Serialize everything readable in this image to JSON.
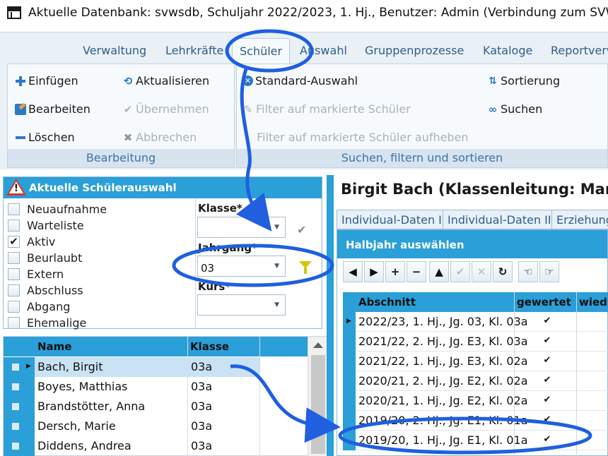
{
  "window": {
    "title": "Aktuelle Datenbank: svwsdb, Schuljahr 2022/2023, 1. Hj., Benutzer: Admin (Verbindung zum SVWS-Serv"
  },
  "ribbon": {
    "tabs": [
      "Verwaltung",
      "Lehrkräfte",
      "Schüler",
      "Auswahl",
      "Gruppenprozesse",
      "Kataloge",
      "Reportverw"
    ],
    "groups": {
      "bearbeitung": {
        "label": "Bearbeitung",
        "buttons": {
          "einfuegen": "Einfügen",
          "bearbeiten": "Bearbeiten",
          "loeschen": "Löschen",
          "aktualisieren": "Aktualisieren",
          "uebernehmen": "Übernehmen",
          "abbrechen": "Abbrechen"
        }
      },
      "suchen": {
        "label": "Suchen, filtern und sortieren",
        "buttons": {
          "standard": "Standard-Auswahl",
          "filter_markiert": "Filter auf markierte Schüler",
          "filter_aufheben": "Filter auf markierte Schüler aufheben",
          "sortierung": "Sortierung",
          "suchen": "Suchen"
        }
      }
    }
  },
  "selection": {
    "title": "Aktuelle Schülerauswahl",
    "statuses": [
      {
        "label": "Neuaufnahme",
        "checked": false
      },
      {
        "label": "Warteliste",
        "checked": false
      },
      {
        "label": "Aktiv",
        "checked": true
      },
      {
        "label": "Beurlaubt",
        "checked": false
      },
      {
        "label": "Extern",
        "checked": false
      },
      {
        "label": "Abschluss",
        "checked": false
      },
      {
        "label": "Abgang",
        "checked": false
      },
      {
        "label": "Ehemalige",
        "checked": false
      }
    ],
    "check_mark": "✔",
    "filters": {
      "klasse": {
        "label": "Klasse*",
        "value": ""
      },
      "jahrgang": {
        "label": "Jahrgang*",
        "value": "03"
      },
      "kurs": {
        "label": "Kurs*",
        "value": ""
      }
    }
  },
  "students": {
    "columns": [
      "Name",
      "Klasse"
    ],
    "rows": [
      {
        "name": "Bach, Birgit",
        "klasse": "03a",
        "selected": true
      },
      {
        "name": "Boyes, Matthias",
        "klasse": "03a",
        "selected": false
      },
      {
        "name": "Brandstötter, Anna",
        "klasse": "03a",
        "selected": false
      },
      {
        "name": "Dersch, Marie",
        "klasse": "03a",
        "selected": false
      },
      {
        "name": "Diddens, Andrea",
        "klasse": "03a",
        "selected": false
      }
    ]
  },
  "detail": {
    "title": "Birgit Bach (Klassenleitung: Mans",
    "tabs": [
      "Individual-Daten I",
      "Individual-Daten II",
      "Erziehung"
    ],
    "halbjahr": {
      "title": "Halbjahr auswählen",
      "toolbar": [
        "◀",
        "▶",
        "+",
        "−",
        "▲",
        "✔",
        "✕",
        "↻",
        "☜",
        "☞"
      ],
      "columns": [
        "Abschnitt",
        "gewertet",
        "wied"
      ],
      "check_mark": "✔",
      "rows": [
        {
          "abschnitt": "2022/23, 1. Hj., Jg. 03, Kl. 03a",
          "gewertet": true
        },
        {
          "abschnitt": "2021/22, 2. Hj., Jg. E3, Kl. 03a",
          "gewertet": true
        },
        {
          "abschnitt": "2021/22, 1. Hj., Jg. E3, Kl. 02a",
          "gewertet": true
        },
        {
          "abschnitt": "2020/21, 2. Hj., Jg. E2, Kl. 02a",
          "gewertet": true
        },
        {
          "abschnitt": "2020/21, 1. Hj., Jg. E2, Kl. 02a",
          "gewertet": true
        },
        {
          "abschnitt": "2019/20, 2. Hj., Jg. E1, Kl. 01a",
          "gewertet": true
        },
        {
          "abschnitt": "2019/20, 1. Hj., Jg. E1, Kl. 01a",
          "gewertet": true
        }
      ]
    }
  },
  "colors": {
    "accent": "#2a9fd8",
    "annotation": "#1f5fe0"
  }
}
